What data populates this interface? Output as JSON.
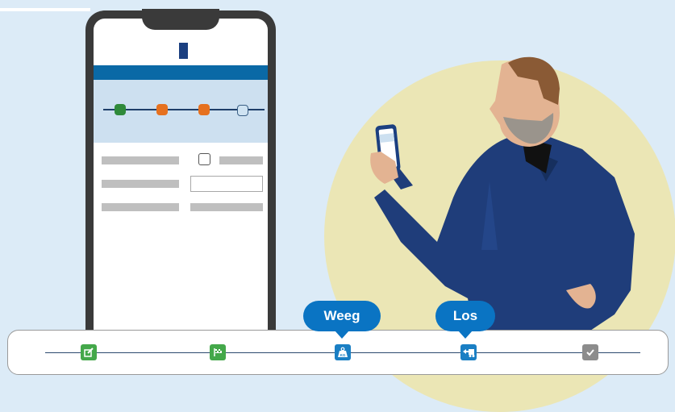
{
  "colors": {
    "background": "#dcebf7",
    "app_bar": "#0a69a6",
    "step_done": "#2f8a3a",
    "step_active": "#e6711f",
    "bubble": "#0a74c3",
    "circle": "#ebe6b5"
  },
  "phone": {
    "progress_steps": [
      "done",
      "active",
      "active",
      "pending"
    ]
  },
  "stepbar": {
    "steps": [
      {
        "icon": "edit-icon",
        "state": "done"
      },
      {
        "icon": "checkered-flag-icon",
        "state": "done"
      },
      {
        "icon": "weight-kg-icon",
        "state": "current",
        "bubble": "Weeg"
      },
      {
        "icon": "unload-truck-icon",
        "state": "current",
        "bubble": "Los"
      },
      {
        "icon": "checkmark-icon",
        "state": "pending"
      }
    ]
  }
}
